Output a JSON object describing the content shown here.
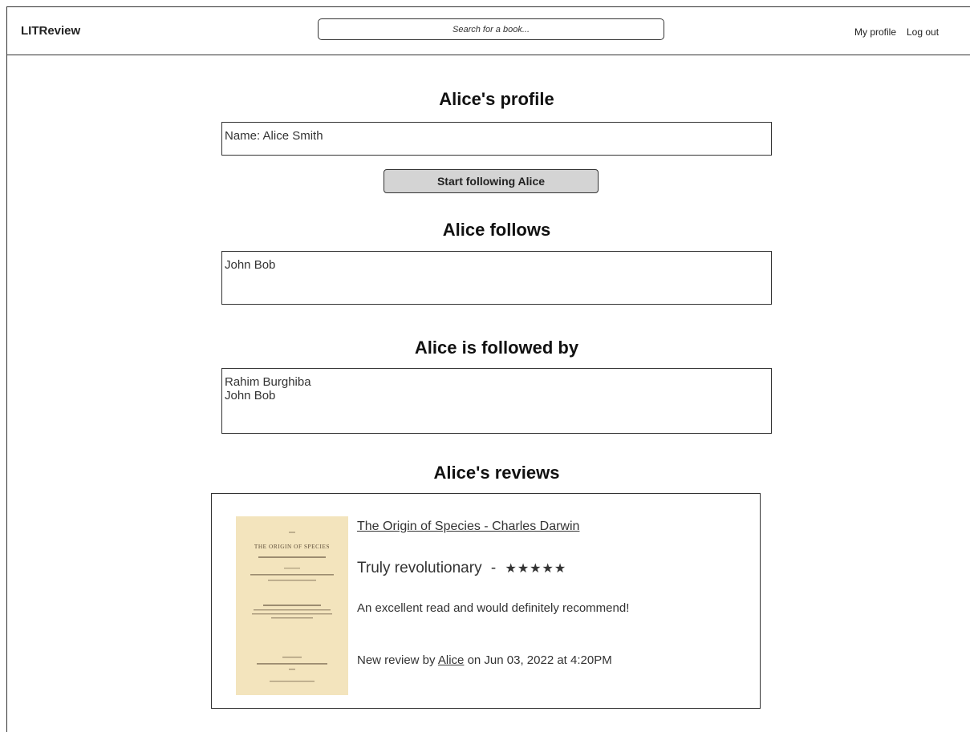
{
  "header": {
    "brand": "LITReview",
    "search_placeholder": "Search for a book...",
    "nav": {
      "my_profile": "My profile",
      "log_out": "Log out"
    }
  },
  "profile": {
    "title": "Alice's profile",
    "name_line": "Name: Alice Smith",
    "follow_button": "Start following Alice"
  },
  "follows": {
    "title": "Alice follows",
    "users": [
      "John Bob"
    ]
  },
  "followed_by": {
    "title": "Alice is followed by",
    "users": [
      "Rahim Burghiba",
      "John Bob"
    ]
  },
  "reviews": {
    "title": "Alice's reviews",
    "items": [
      {
        "book": "The Origin of Species - Charles Darwin",
        "headline": "Truly revolutionary",
        "separator": "-",
        "stars": "★★★★★",
        "rating": 5,
        "body": "An excellent read and would definitely recommend!",
        "meta_prefix": "New review by",
        "author": "Alice",
        "meta_suffix": "on Jun 03, 2022 at 4:20PM",
        "cover_lines": [
          "THE ORIGIN OF SPECIES"
        ]
      }
    ]
  },
  "colors": {
    "button_bg": "#d4d4d4",
    "cover_bg": "#f3e4bd",
    "border": "#333333"
  }
}
